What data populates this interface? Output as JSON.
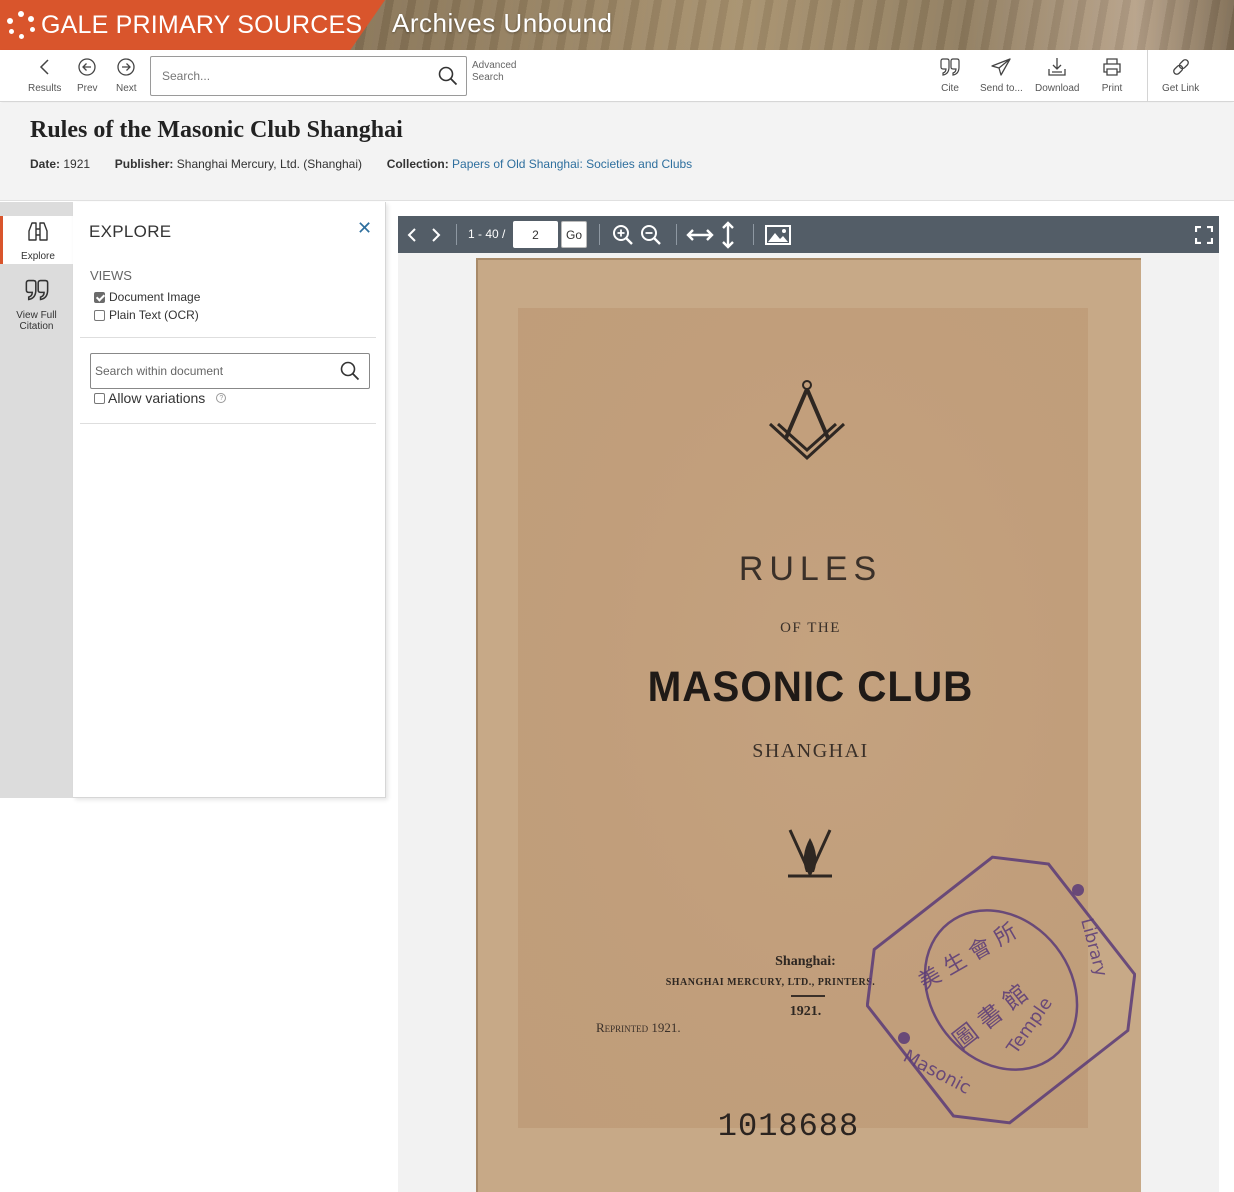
{
  "banner": {
    "brand": "GALE PRIMARY SOURCES",
    "product": "Archives Unbound",
    "brand_color": "#d9552c"
  },
  "toolbar": {
    "results_label": "Results",
    "prev_label": "Prev",
    "next_label": "Next",
    "search_placeholder": "Search...",
    "advanced_search_label": "Advanced Search",
    "cite_label": "Cite",
    "send_label": "Send to...",
    "download_label": "Download",
    "print_label": "Print",
    "get_link_label": "Get Link"
  },
  "document": {
    "title": "Rules of the Masonic Club Shanghai",
    "date_label": "Date:",
    "date": "1921",
    "publisher_label": "Publisher:",
    "publisher": "Shanghai Mercury, Ltd. (Shanghai)",
    "collection_label": "Collection:",
    "collection": "Papers of Old Shanghai: Societies and Clubs",
    "link_color": "#2e6f9e"
  },
  "rail": {
    "explore_label": "Explore",
    "citation_label": "View Full Citation"
  },
  "explore": {
    "title": "EXPLORE",
    "close_glyph": "✕",
    "views_heading": "VIEWS",
    "view_options": [
      {
        "label": "Document Image",
        "checked": true
      },
      {
        "label": "Plain Text (OCR)",
        "checked": false
      }
    ],
    "search_within_placeholder": "Search within document",
    "allow_variations_label": "Allow variations",
    "allow_variations_checked": false,
    "help_glyph": "?"
  },
  "viewer": {
    "page_count": "1 - 40 /",
    "current_page": "2",
    "go_label": "Go"
  },
  "page_image": {
    "heading": "RULES",
    "of_the": "OF THE",
    "club_name": "MASONIC CLUB",
    "city": "SHANGHAI",
    "imprint_city": "Shanghai:",
    "printer": "SHANGHAI MERCURY, LTD., PRINTERS.",
    "year": "1921.",
    "reprinted": "Reprinted 1921.",
    "accession_number": "1018688",
    "stamp_latin": "Masonic Temple Library",
    "stamp_chinese": "美生會所 圖書館",
    "paper_color": "#c7a987",
    "stamp_color": "#5a3b78"
  }
}
